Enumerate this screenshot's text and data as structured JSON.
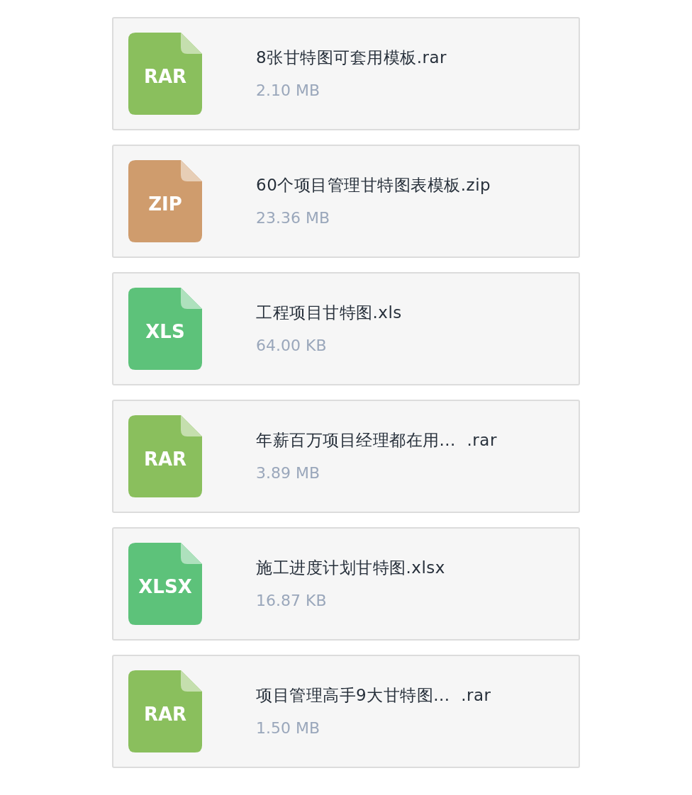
{
  "files": [
    {
      "type_label": "RAR",
      "color": "#8abf5d",
      "name": "8张甘特图可套用模板.rar",
      "size": "2.10 MB"
    },
    {
      "type_label": "ZIP",
      "color": "#cf9c6d",
      "name": "60个项目管理甘特图表模板.zip",
      "size": "23.36 MB"
    },
    {
      "type_label": "XLS",
      "color": "#5dc27a",
      "name": "工程项目甘特图.xls",
      "size": "64.00 KB"
    },
    {
      "type_label": "RAR",
      "color": "#8abf5d",
      "name": "年薪百万项目经理都在用...  .rar",
      "size": "3.89 MB"
    },
    {
      "type_label": "XLSX",
      "color": "#5dc27a",
      "name": "施工进度计划甘特图.xlsx",
      "size": "16.87 KB"
    },
    {
      "type_label": "RAR",
      "color": "#8abf5d",
      "name": "项目管理高手9大甘特图...  .rar",
      "size": "1.50 MB"
    }
  ]
}
